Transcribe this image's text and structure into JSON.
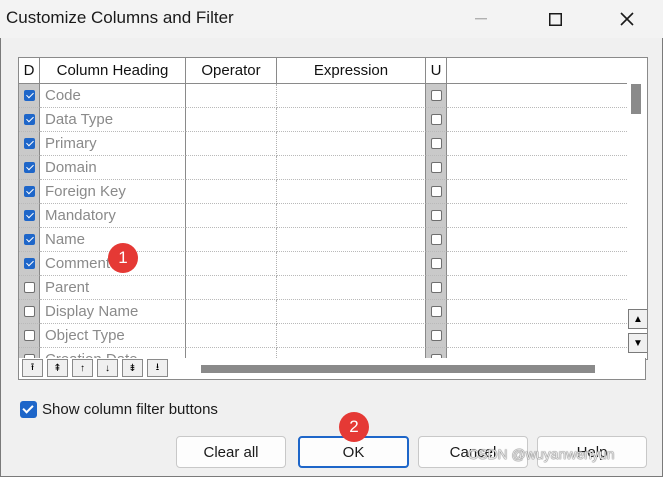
{
  "window": {
    "title": "Customize Columns and Filter"
  },
  "grid": {
    "headers": {
      "d": "D",
      "column_heading": "Column Heading",
      "operator": "Operator",
      "expression": "Expression",
      "u": "U"
    },
    "rows": [
      {
        "label": "Code",
        "displayed": true,
        "u": false
      },
      {
        "label": "Data Type",
        "displayed": true,
        "u": false
      },
      {
        "label": "Primary",
        "displayed": true,
        "u": false
      },
      {
        "label": "Domain",
        "displayed": true,
        "u": false
      },
      {
        "label": "Foreign Key",
        "displayed": true,
        "u": false
      },
      {
        "label": "Mandatory",
        "displayed": true,
        "u": false
      },
      {
        "label": "Name",
        "displayed": true,
        "u": false
      },
      {
        "label": "Comment",
        "displayed": true,
        "u": false
      },
      {
        "label": "Parent",
        "displayed": false,
        "u": false
      },
      {
        "label": "Display Name",
        "displayed": false,
        "u": false
      },
      {
        "label": "Object Type",
        "displayed": false,
        "u": false
      },
      {
        "label": "Creation Date",
        "displayed": false,
        "u": false
      }
    ]
  },
  "nav_buttons": [
    "move-to-top",
    "move-page-up",
    "move-up",
    "move-down",
    "move-page-down",
    "move-to-bottom"
  ],
  "options": {
    "show_filter_label": "Show column filter buttons",
    "show_filter_checked": true
  },
  "buttons": {
    "clear_all": "Clear all",
    "ok": "OK",
    "cancel": "Cancel",
    "help": "Help"
  },
  "annotations": {
    "badge1": "1",
    "badge2": "2"
  },
  "watermark": "CSDN @wuyanwenyun",
  "colors": {
    "accent": "#1e66c9",
    "badge": "#e53935"
  }
}
